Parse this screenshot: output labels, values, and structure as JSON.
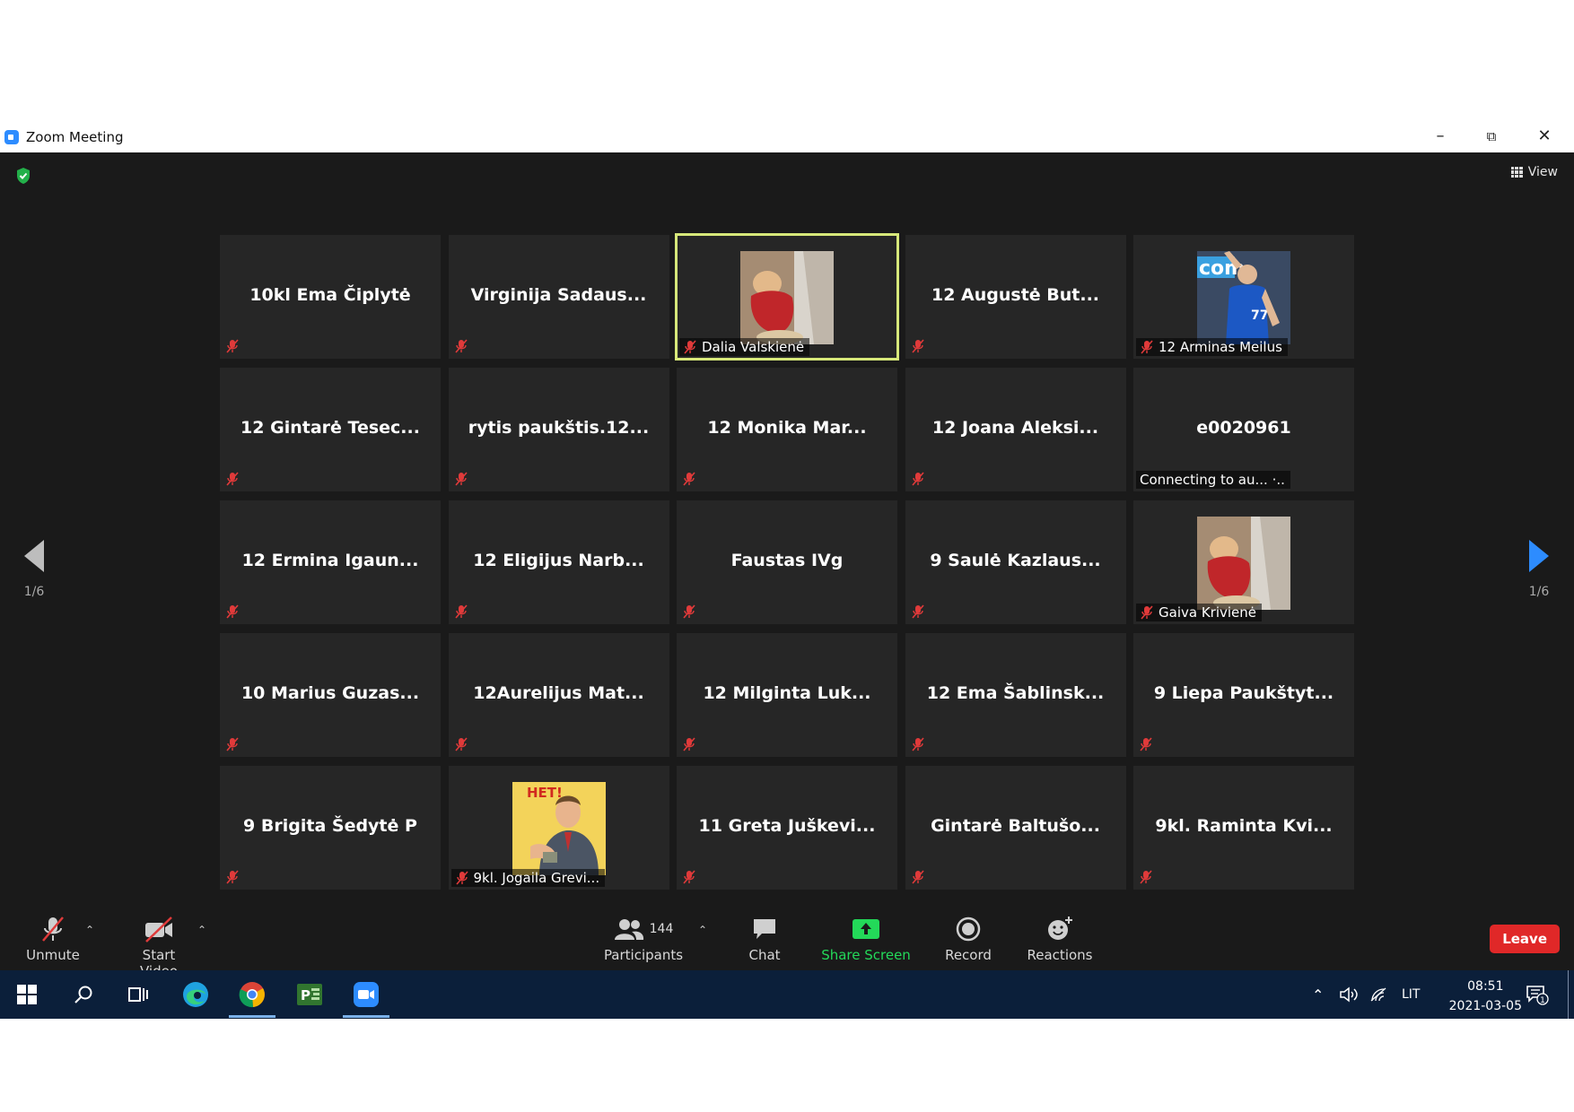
{
  "window": {
    "title": "Zoom Meeting"
  },
  "header": {
    "view_label": "View"
  },
  "colors": {
    "active_border": "#d7e87a",
    "leave": "#e02828",
    "share": "#23d959",
    "muted": "#e03a3a"
  },
  "tiles": [
    {
      "name": "10kl Ema Čiplytė",
      "label": ""
    },
    {
      "name": "Virginija  Sadaus...",
      "label": ""
    },
    {
      "name": "",
      "label": "Dalia Valskienė",
      "image": "dog-photo",
      "active": true
    },
    {
      "name": "12 Augustė But...",
      "label": ""
    },
    {
      "name": "",
      "label": "12 Arminas Meilus",
      "image": "basketball-photo"
    },
    {
      "name": "12 Gintarė Tesec...",
      "label": ""
    },
    {
      "name": "rytis  paukštis.12...",
      "label": ""
    },
    {
      "name": "12 Monika Mar...",
      "label": ""
    },
    {
      "name": "12 Joana Aleksi...",
      "label": ""
    },
    {
      "name": "e0020961",
      "label": "Connecting to au... ·..",
      "connecting": true
    },
    {
      "name": "12 Ermina Igaun...",
      "label": ""
    },
    {
      "name": "12 Eligijus Narb...",
      "label": ""
    },
    {
      "name": "Faustas IVg",
      "label": ""
    },
    {
      "name": "9 Saulė Kazlaus...",
      "label": ""
    },
    {
      "name": "",
      "label": "Gaiva Krivienė",
      "image": "dog-photo"
    },
    {
      "name": "10 Marius Guzas...",
      "label": ""
    },
    {
      "name": "12Aurelijus  Mat...",
      "label": ""
    },
    {
      "name": "12 Milginta Luk...",
      "label": ""
    },
    {
      "name": "12 Ema Šablinsk...",
      "label": ""
    },
    {
      "name": "9 Liepa Paukštyt...",
      "label": ""
    },
    {
      "name": "9 Brigita Šedytė P",
      "label": ""
    },
    {
      "name": "",
      "label": "9kl. Jogaila Grevi...",
      "image": "poster-photo",
      "poster_text": "HET!"
    },
    {
      "name": "11 Greta Juškevi...",
      "label": ""
    },
    {
      "name": "Gintarė Baltušo...",
      "label": ""
    },
    {
      "name": "9kl.  Raminta Kvi...",
      "label": ""
    }
  ],
  "pagination": {
    "left": "1/6",
    "right": "1/6"
  },
  "toolbar": {
    "unmute": "Unmute",
    "start_video": "Start Video",
    "participants": "Participants",
    "participants_count": "144",
    "chat": "Chat",
    "share_screen": "Share Screen",
    "record": "Record",
    "reactions": "Reactions",
    "leave": "Leave"
  },
  "taskbar": {
    "language": "LIT",
    "time": "08:51",
    "date": "2021-03-05",
    "notifications": "1"
  }
}
